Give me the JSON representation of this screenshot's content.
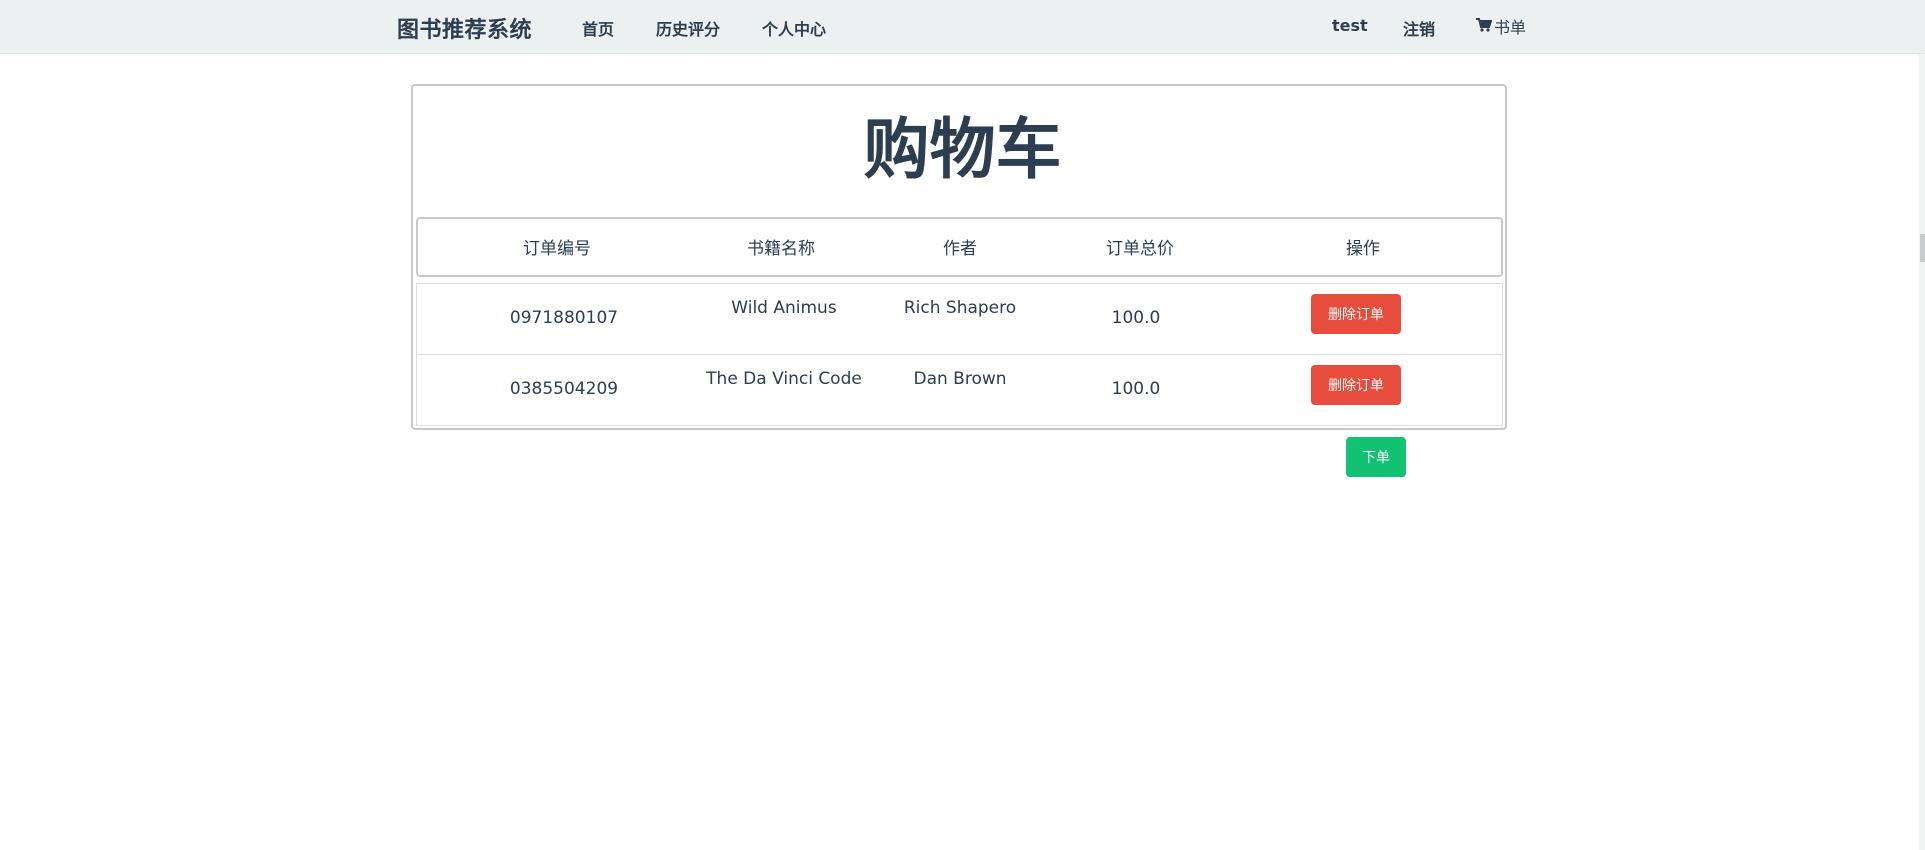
{
  "navbar": {
    "brand": "图书推荐系统",
    "links": [
      "首页",
      "历史评分",
      "个人中心"
    ],
    "user": "test",
    "logout": "注销",
    "cart_label": "书单",
    "cart_icon": "cart-icon"
  },
  "page": {
    "title": "购物车"
  },
  "table": {
    "headers": [
      "订单编号",
      "书籍名称",
      "作者",
      "订单总价",
      "操作"
    ],
    "rows": [
      {
        "id": "0971880107",
        "book": "Wild Animus",
        "author": "Rich Shapero",
        "price": "100.0",
        "action": "删除订单"
      },
      {
        "id": "0385504209",
        "book": "The Da Vinci Code",
        "author": "Dan Brown",
        "price": "100.0",
        "action": "删除订单"
      }
    ]
  },
  "submit_label": "下单",
  "colors": {
    "navbar_bg": "#ecf0f1",
    "text": "#2c3e50",
    "danger": "#e74c3c",
    "success": "#12c272"
  }
}
